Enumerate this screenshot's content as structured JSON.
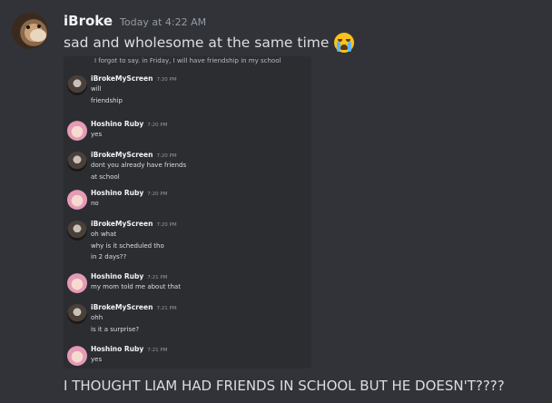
{
  "message": {
    "username": "iBroke",
    "timestamp": "Today at 4:22 AM",
    "text": "sad and wholesome at the same time",
    "emoji": "loudly-crying-face-emoji"
  },
  "screenshot": {
    "cut_line": "I forgot to say. in Friday, I will have friendship in my school",
    "messages": [
      {
        "author": "iBrokeMyScreen",
        "time": "7:20 PM",
        "lines": [
          "will",
          "friendship"
        ],
        "avatar": "ibroke"
      },
      {
        "author": "Hoshino Ruby",
        "time": "7:20 PM",
        "lines": [
          "yes"
        ],
        "avatar": "ruby"
      },
      {
        "author": "iBrokeMyScreen",
        "time": "7:20 PM",
        "lines": [
          "dont you already have friends",
          "at school"
        ],
        "avatar": "ibroke"
      },
      {
        "author": "Hoshino Ruby",
        "time": "7:20 PM",
        "lines": [
          "no"
        ],
        "avatar": "ruby"
      },
      {
        "author": "iBrokeMyScreen",
        "time": "7:20 PM",
        "lines": [
          "oh what",
          "why is it scheduled tho",
          "in 2 days??"
        ],
        "avatar": "ibroke"
      },
      {
        "author": "Hoshino Ruby",
        "time": "7:21 PM",
        "lines": [
          "my mom told me about that"
        ],
        "avatar": "ruby"
      },
      {
        "author": "iBrokeMyScreen",
        "time": "7:21 PM",
        "lines": [
          "ohh",
          "is it a surprise?"
        ],
        "avatar": "ibroke"
      },
      {
        "author": "Hoshino Ruby",
        "time": "7:21 PM",
        "lines": [
          "yes"
        ],
        "avatar": "ruby"
      }
    ]
  },
  "followup": {
    "text": "I THOUGHT LIAM HAD FRIENDS IN SCHOOL BUT HE DOESN'T????"
  },
  "colors": {
    "background": "#313338",
    "embed_background": "#2b2d31",
    "text": "#dbdee1",
    "muted": "#949ba4"
  }
}
